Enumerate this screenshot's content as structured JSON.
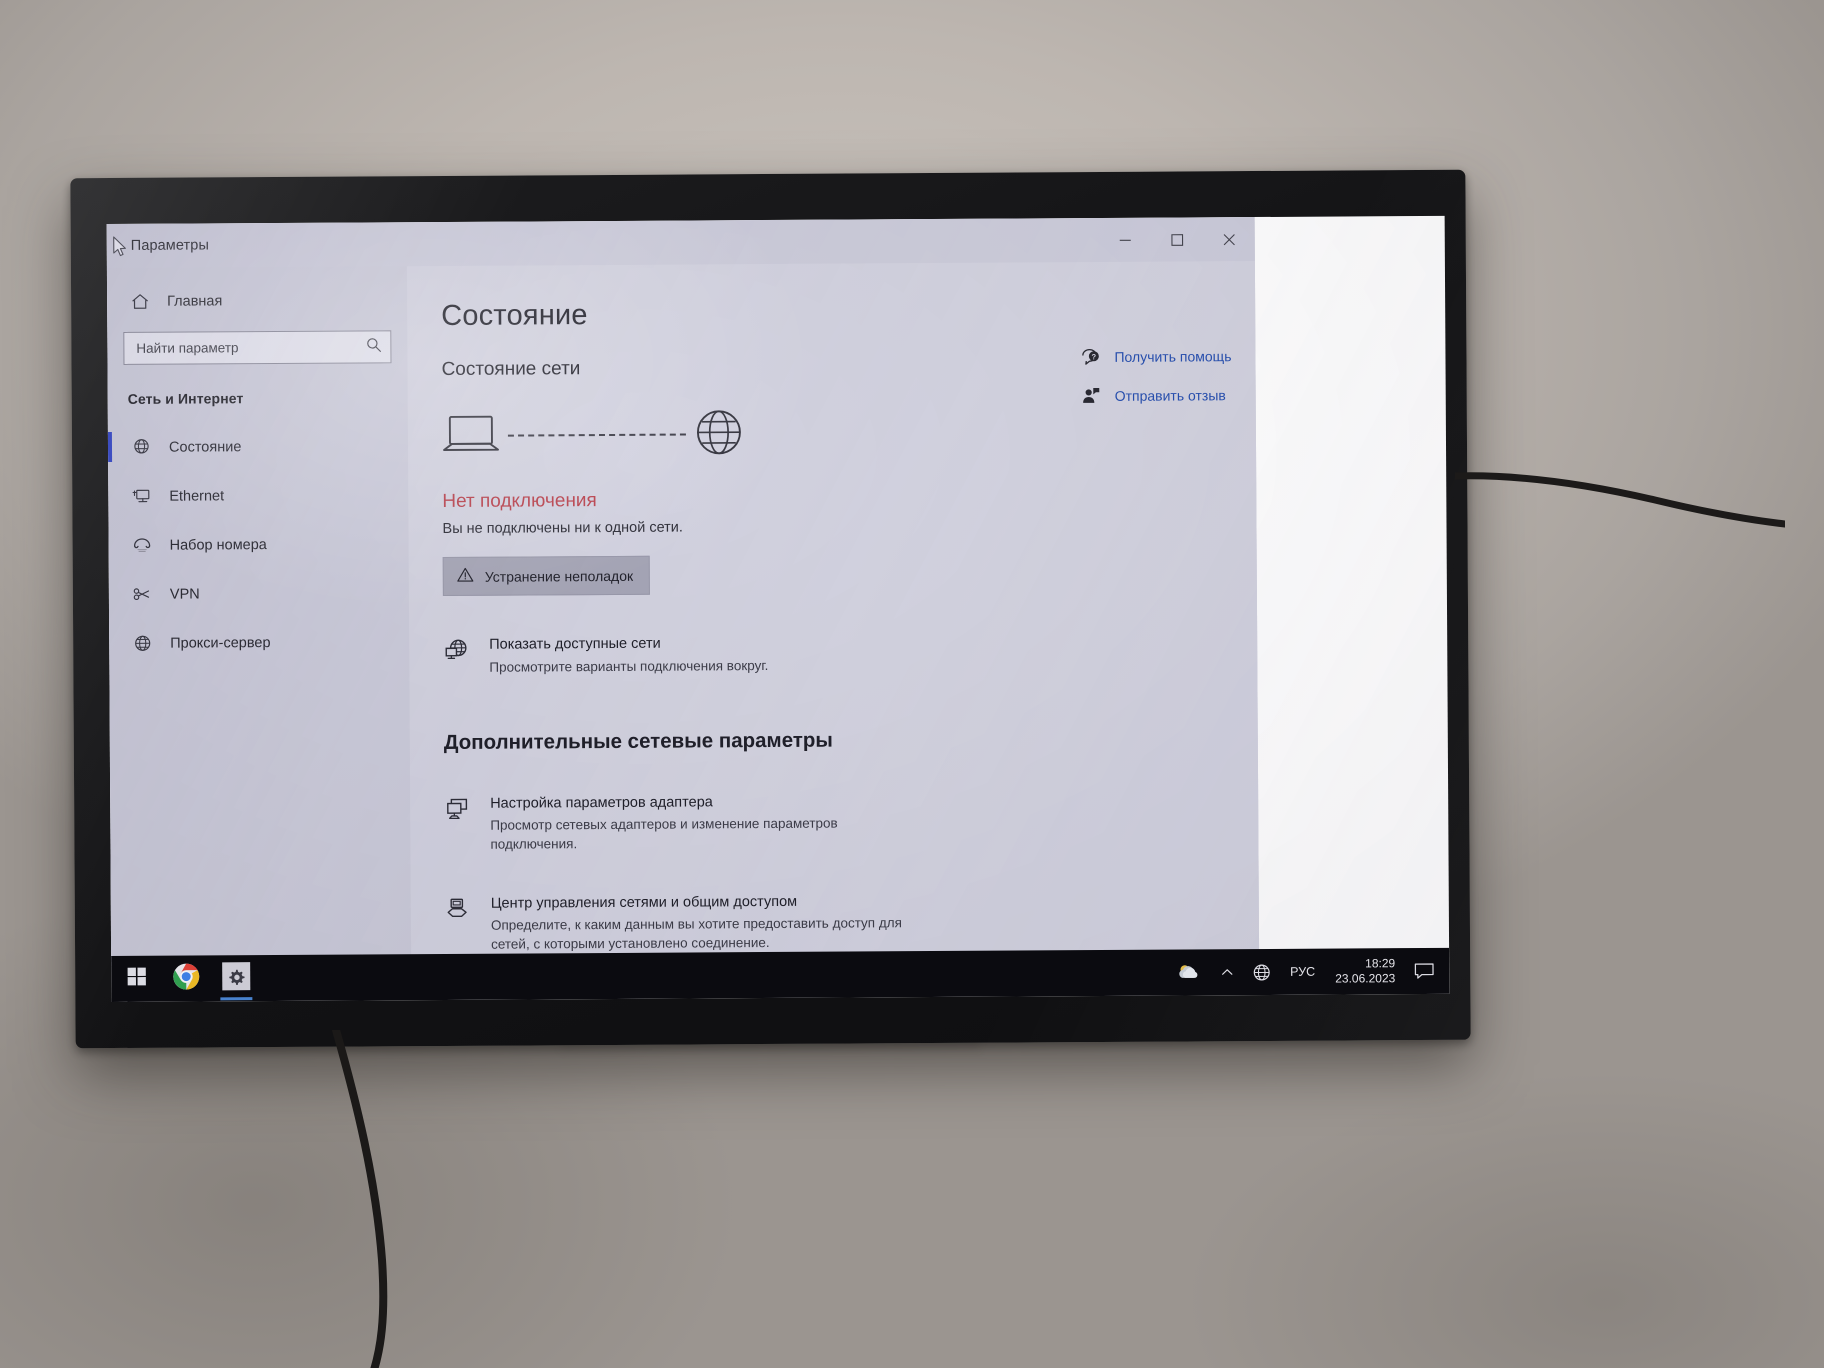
{
  "window": {
    "title": "Параметры",
    "minimize_label": "Свернуть",
    "maximize_label": "Развернуть",
    "close_label": "Закрыть"
  },
  "sidebar": {
    "home": {
      "label": "Главная",
      "icon": "home-icon"
    },
    "search": {
      "placeholder": "Найти параметр",
      "icon": "search-icon"
    },
    "section": "Сеть и Интернет",
    "items": [
      {
        "label": "Состояние",
        "icon": "globe-status-icon",
        "selected": true
      },
      {
        "label": "Ethernet",
        "icon": "ethernet-icon",
        "selected": false
      },
      {
        "label": "Набор номера",
        "icon": "dialup-icon",
        "selected": false
      },
      {
        "label": "VPN",
        "icon": "vpn-icon",
        "selected": false
      },
      {
        "label": "Прокси-сервер",
        "icon": "proxy-globe-icon",
        "selected": false
      }
    ]
  },
  "main": {
    "page_title": "Состояние",
    "network_status_heading": "Состояние сети",
    "diagram": {
      "device_icon": "laptop-icon",
      "link_icon": "dashed-line",
      "internet_icon": "globe-icon"
    },
    "status": {
      "title": "Нет подключения",
      "description": "Вы не подключены ни к одной сети.",
      "color": "#b9414c"
    },
    "troubleshoot_button": {
      "label": "Устранение неполадок",
      "icon": "warning-triangle-icon"
    },
    "show_networks": {
      "title": "Показать доступные сети",
      "subtitle": "Просмотрите варианты подключения вокруг.",
      "icon": "available-networks-icon"
    },
    "advanced_heading": "Дополнительные сетевые параметры",
    "advanced_links": [
      {
        "title": "Настройка параметров адаптера",
        "subtitle": "Просмотр сетевых адаптеров и изменение параметров подключения.",
        "icon": "adapter-icon"
      },
      {
        "title": "Центр управления сетями и общим доступом",
        "subtitle": "Определите, к каким данным вы хотите предоставить доступ для сетей, с которыми установлено соединение.",
        "icon": "sharing-center-icon"
      }
    ]
  },
  "right_rail": {
    "links": [
      {
        "label": "Получить помощь",
        "icon": "help-question-icon",
        "color": "#2850b0"
      },
      {
        "label": "Отправить отзыв",
        "icon": "feedback-person-icon",
        "color": "#2850b0"
      }
    ]
  },
  "taskbar": {
    "start": {
      "icon": "windows-start-icon"
    },
    "apps": [
      {
        "icon": "chrome-icon",
        "name": "Google Chrome",
        "active": false
      },
      {
        "icon": "settings-gear-icon",
        "name": "Параметры",
        "active": true
      }
    ],
    "tray": {
      "weather_icon": "weather-cloud-icon",
      "chevron_icon": "chevron-up-icon",
      "network_icon": "network-globe-icon",
      "language": "РУС",
      "time": "18:29",
      "date": "23.06.2023",
      "action_center_icon": "notification-icon"
    }
  },
  "colors": {
    "accent": "#3b4dc8",
    "link": "#2850b0",
    "error": "#b9414c",
    "window_bg": "#d3d3e0",
    "sidebar_bg": "#ccccda"
  }
}
